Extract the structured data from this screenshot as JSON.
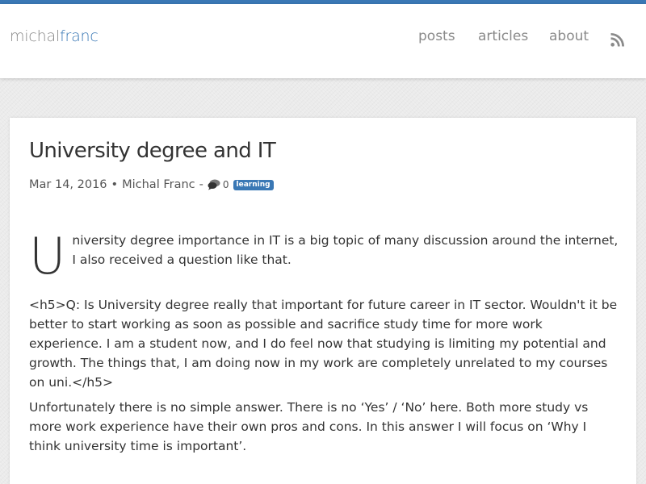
{
  "brand": {
    "first": "michal",
    "last": "franc"
  },
  "nav": {
    "posts": "posts",
    "articles": "articles",
    "about": "about",
    "rss_icon": "rss-icon"
  },
  "post": {
    "title": "University degree and IT",
    "date": "Mar 14, 2016",
    "bullet": "•",
    "author": "Michal Franc",
    "dash": "-",
    "comment_count": "0",
    "tag": "learning",
    "drop_cap": "U",
    "p1_rest": "niversity degree importance in IT is a big topic of many discussion around the internet, I also received a question like that.",
    "p2": "<h5>Q: Is University degree really that important for future career in IT sector. Wouldn't it be better to start working as soon as possible and sacrifice study time for more work experience. I am a student now, and I do feel now that studying is limiting my potential and growth. The things that, I am doing now in my work are completely unrelated to my courses on uni.</h5>",
    "p3": "Unfortunately there is no simple answer. There is no ‘Yes’ / ‘No’ here. Both more study vs more work experience have their own pros and cons. In this answer I will focus on ‘Why I think university time is important’."
  },
  "colors": {
    "accent": "#3a78b5",
    "background": "#ebebeb",
    "text": "#333333",
    "nav_text": "#8a8a8a"
  }
}
